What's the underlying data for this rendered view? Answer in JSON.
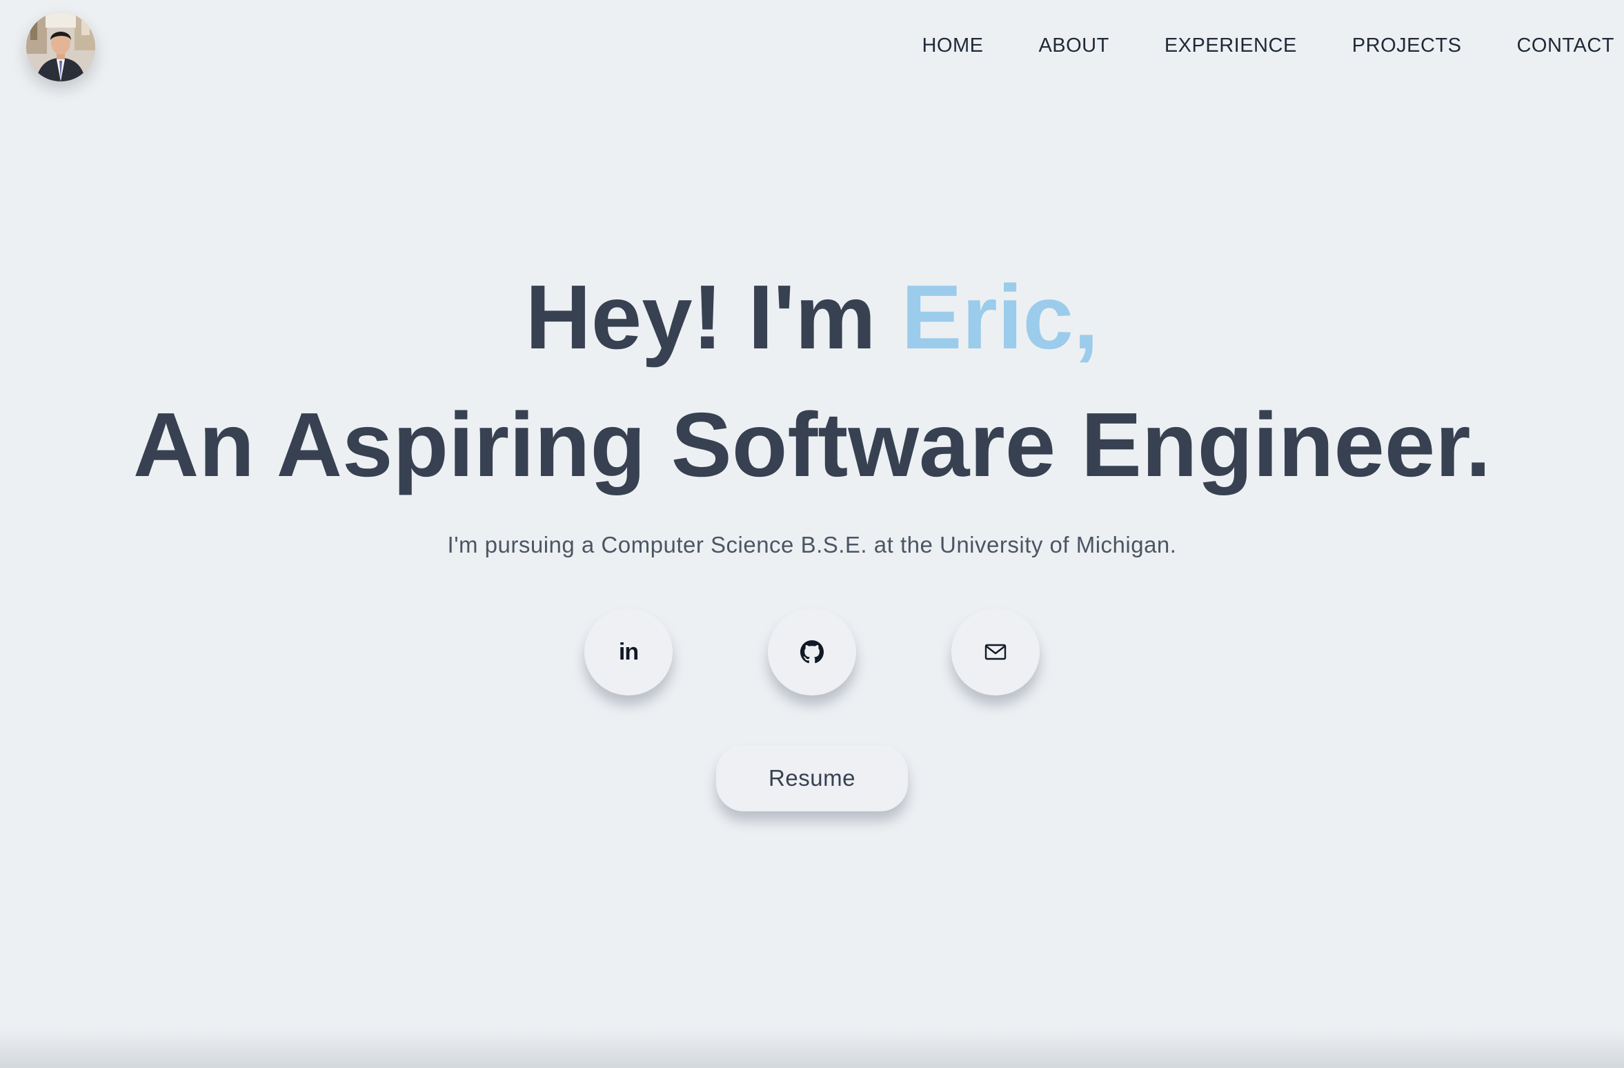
{
  "header": {
    "avatar_alt": "Profile photo",
    "nav": [
      {
        "label": "HOME"
      },
      {
        "label": "ABOUT"
      },
      {
        "label": "EXPERIENCE"
      },
      {
        "label": "PROJECTS"
      },
      {
        "label": "CONTACT"
      }
    ]
  },
  "hero": {
    "greeting": "Hey! I'm ",
    "name": "Eric,",
    "tagline": "An Aspiring Software Engineer.",
    "subtitle": "I'm pursuing a Computer Science B.S.E. at the University of Michigan.",
    "accent_color": "#9bcceb"
  },
  "social": {
    "linkedin_glyph": "in",
    "linkedin_icon": "linkedin-icon",
    "github_icon": "github-icon",
    "email_icon": "mail-icon"
  },
  "resume": {
    "label": "Resume"
  }
}
